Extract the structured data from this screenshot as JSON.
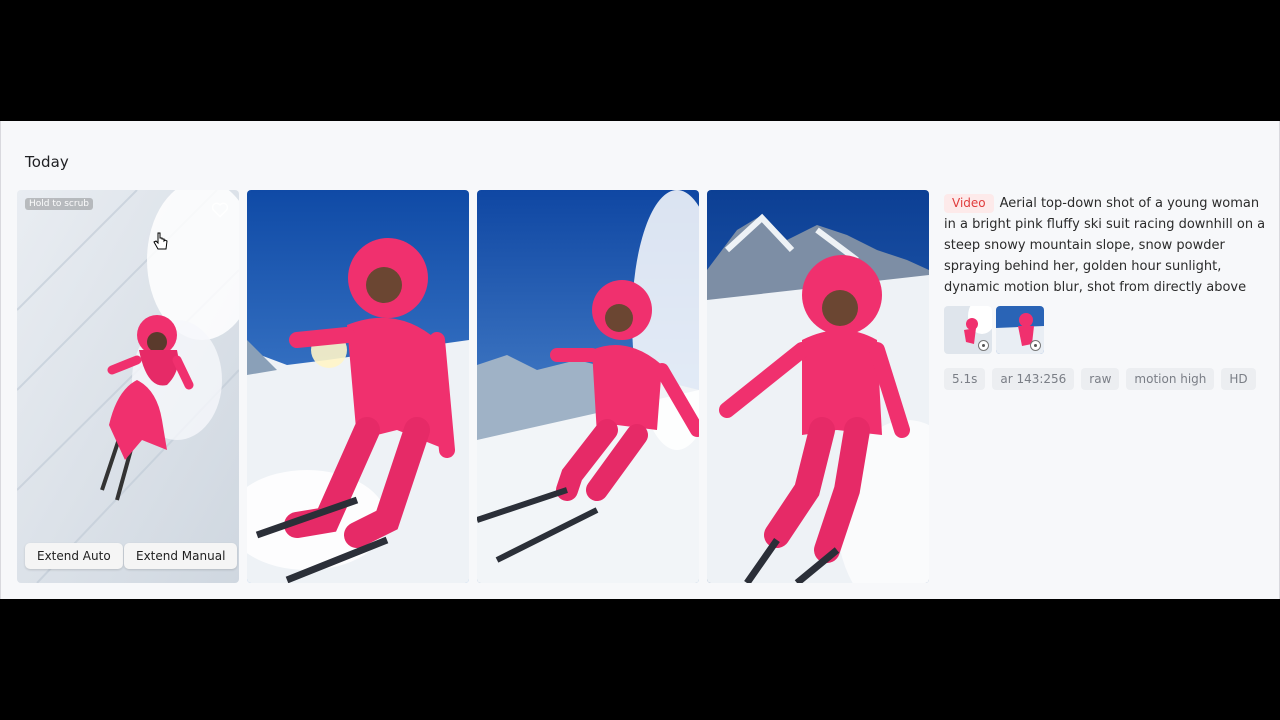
{
  "section": {
    "title": "Today"
  },
  "card": {
    "scrub_label": "Hold to scrub",
    "extend_auto": "Extend Auto",
    "extend_manual": "Extend Manual"
  },
  "detail": {
    "type_badge": "Video",
    "prompt": "Aerial top-down shot of a young woman in a bright pink fluffy ski suit racing downhill on a steep snowy mountain slope, snow powder spraying behind her, golden hour sunlight, dynamic motion blur, shot from directly above",
    "tags": [
      "5.1s",
      "ar 143:256",
      "raw",
      "motion high",
      "HD"
    ]
  },
  "icons": [
    "heart-icon",
    "pointer-hand-icon",
    "play-icon"
  ],
  "colors": {
    "suit_pink": "#f0306e",
    "badge_red": "#e03c3c",
    "sky_blue": "#1e5fb8"
  }
}
